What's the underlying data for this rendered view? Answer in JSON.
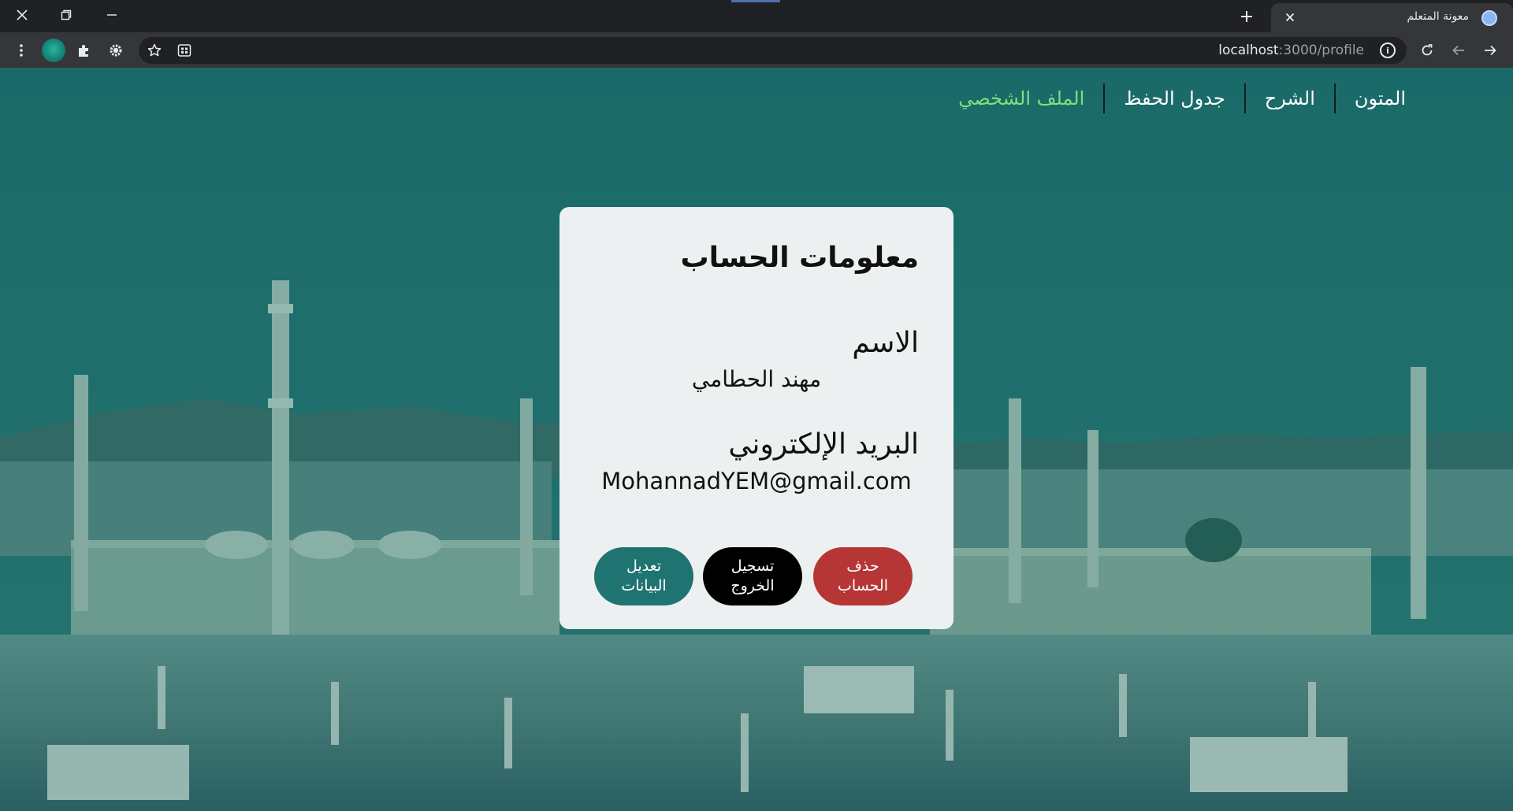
{
  "browser": {
    "tab_title": "معونة المتعلم",
    "url_host": "localhost",
    "url_path": ":3000/profile",
    "window": {
      "close_icon": "close-icon",
      "restore_icon": "restore-icon",
      "minimize_icon": "minimize-icon"
    }
  },
  "nav": {
    "items": [
      {
        "label": "المتون",
        "active": false
      },
      {
        "label": "الشرح",
        "active": false
      },
      {
        "label": "جدول الحفظ",
        "active": false
      },
      {
        "label": "الملف الشخصي",
        "active": true
      }
    ]
  },
  "card": {
    "title": "معلومات الحساب",
    "name_label": "الاسم",
    "name_value": "مهند الحطامي",
    "email_label": "البريد الإلكتروني",
    "email_value": "MohannadYEM@gmail.com",
    "buttons": {
      "delete": "حذف الحساب",
      "logout": "تسجيل الخروج",
      "edit": "تعديل البيانات"
    }
  },
  "colors": {
    "active_nav": "#7ce17c",
    "edit_button": "#1f7472",
    "logout_button": "#000000",
    "delete_button": "#b63636"
  }
}
